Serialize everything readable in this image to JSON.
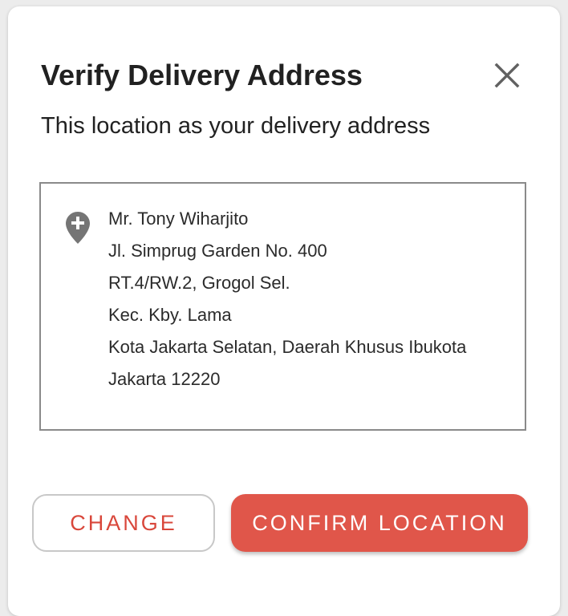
{
  "dialog": {
    "title": "Verify Delivery Address",
    "subtitle": "This location as your delivery address",
    "close_icon": "close-icon"
  },
  "address": {
    "icon": "location-pin-icon",
    "lines": [
      "Mr. Tony Wiharjito",
      "Jl. Simprug Garden No. 400",
      "RT.4/RW.2, Grogol Sel.",
      "Kec. Kby. Lama",
      "Kota Jakarta Selatan, Daerah Khusus Ibukota",
      "Jakarta 12220"
    ]
  },
  "actions": {
    "change_label": "CHANGE",
    "confirm_label": "CONFIRM LOCATION"
  },
  "colors": {
    "accent": "#e0564a",
    "accent_text": "#d9473b",
    "border": "#8a8a8a"
  }
}
